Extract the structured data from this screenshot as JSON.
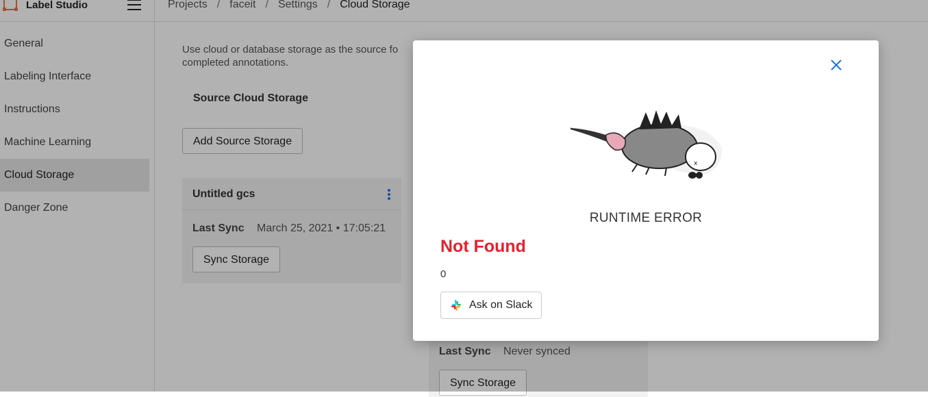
{
  "app": {
    "title": "Label Studio"
  },
  "breadcrumb": [
    "Projects",
    "faceit",
    "Settings",
    "Cloud Storage"
  ],
  "sidebar": {
    "items": [
      {
        "label": "General"
      },
      {
        "label": "Labeling Interface"
      },
      {
        "label": "Instructions"
      },
      {
        "label": "Machine Learning"
      },
      {
        "label": "Cloud Storage",
        "active": true
      },
      {
        "label": "Danger Zone"
      }
    ]
  },
  "main": {
    "description_line1": "Use cloud or database storage as the source fo",
    "description_line2": "completed annotations.",
    "source_title": "Source Cloud Storage",
    "add_source_label": "Add Source Storage",
    "source_card": {
      "title": "Untitled gcs",
      "last_sync_label": "Last Sync",
      "last_sync_value": "March 25, 2021  •  17:05:21",
      "sync_button": "Sync Storage"
    },
    "target_card": {
      "last_sync_label": "Last Sync",
      "last_sync_value": "Never synced",
      "sync_button": "Sync Storage"
    }
  },
  "modal": {
    "error_title": "RUNTIME ERROR",
    "error_message": "Not Found",
    "error_detail": "0",
    "slack_button": "Ask on Slack"
  },
  "colors": {
    "accent": "#1a73e8",
    "error": "#e7202d",
    "overlay": "rgba(0,0,0,0.30)"
  }
}
